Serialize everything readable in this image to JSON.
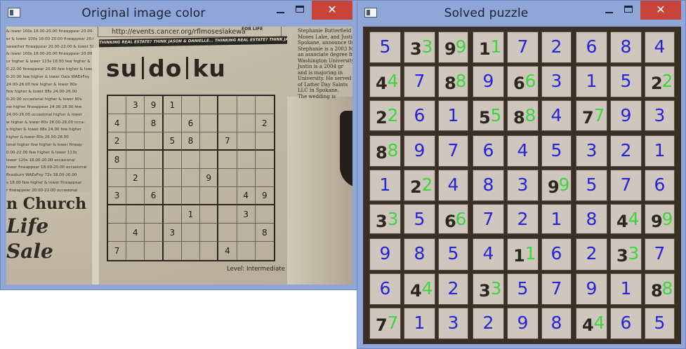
{
  "windows": {
    "original": {
      "title": "Original image color",
      "close_label": "✕"
    },
    "solved": {
      "title": "Solved puzzle",
      "close_label": "✕"
    }
  },
  "newspaper": {
    "url": "http://events.cancer.org/rflmoseslakewa",
    "for_life": "FOR LIFE",
    "banner": "THINKING REAL ESTATE? THINK JASON & DANIELLE... THINKING REAL ESTATE? THINK JASON & DANIELLE... THINKING REAL ESTATE?",
    "logo_parts": [
      "su",
      "do",
      "ku"
    ],
    "level": "Level: Intermediate",
    "church_lines": [
      "n Church",
      "Life",
      "Sale"
    ],
    "left_column": [
      "& lower 100s 18.00-20.00 fineappear 20.00-22.00",
      "er & lower 100s 18.00-20.00 fineappear 20.00-22.00",
      "sweather fineappear 20.00-22.00 & lower 50s",
      "& lower 100s 18.00-20.00 fineappear 20.00-22.00",
      "ur higher & lower 113s 18.00 few higher &",
      "0-22.00 fineappear 20.00 few higher & lower",
      "0-20.00 few higher & lower Dala WAExFoy",
      "24.00-26.00 few higher & lower 80s",
      "few higher & lower 88s 24.00-26.00",
      "0-20.00 occasional higher & lower 80s",
      "ow higher fineappear 24.00-26.00 few",
      "24.00-26.00 occasional higher & lower",
      "w higher & lower 80s 26.00-28.00 occa-",
      "s higher & lower 88s 24.00 few higher",
      "higher & lower 80s 26.00-28.00",
      "ional higher fow higher & lower fineap-",
      "0.00-22.00 few higher & lower 113s",
      "lower 120s 18.00-20.00 occasional",
      "lower fineappear 18.00-20.00 occasional",
      "Rrasburn WAExFoy 72s 18.00-20.00",
      "s 18.00 few higher & lower fineappear",
      "r fineappear 20.00-22.00 occasional",
      "s 18.00-20.00 fineappear 20.00-22.00",
      "lower 88s 18.00-20.00 fineappear",
      "00 occasional lower 100s 15.00-16.00",
      "r 18.00 few higher & lower cartons"
    ],
    "right_column": [
      "Stephanie Butterfield",
      "Moses Lake, and Justin",
      "Spokane, announce their",
      "Stephanie is a 2003 M",
      "an associate degree fr",
      "Washington University",
      "Justin is a 2004 gr",
      "and is majoring in",
      "University. He served",
      "of Latter Day Saints",
      "LLC in Spokane.",
      "The wedding is"
    ],
    "grid": [
      [
        "",
        "3",
        "9",
        "1",
        "",
        "",
        "",
        "",
        ""
      ],
      [
        "4",
        "",
        "8",
        "",
        "6",
        "",
        "",
        "",
        "2"
      ],
      [
        "2",
        "",
        "",
        "5",
        "8",
        "",
        "7",
        "",
        ""
      ],
      [
        "8",
        "",
        "",
        "",
        "",
        "",
        "",
        "",
        ""
      ],
      [
        "",
        "2",
        "",
        "",
        "",
        "9",
        "",
        "",
        ""
      ],
      [
        "3",
        "",
        "6",
        "",
        "",
        "",
        "",
        "4",
        "9"
      ],
      [
        "",
        "",
        "",
        "",
        "1",
        "",
        "",
        "3",
        ""
      ],
      [
        "",
        "4",
        "",
        "3",
        "",
        "",
        "",
        "",
        "8"
      ],
      [
        "7",
        "",
        "",
        "",
        "",
        "",
        "4",
        "",
        ""
      ]
    ]
  },
  "solved_grid": [
    [
      "5",
      "3",
      "9",
      "1",
      "7",
      "2",
      "6",
      "8",
      "4"
    ],
    [
      "4",
      "7",
      "8",
      "9",
      "6",
      "3",
      "1",
      "5",
      "2"
    ],
    [
      "2",
      "6",
      "1",
      "5",
      "8",
      "4",
      "7",
      "9",
      "3"
    ],
    [
      "8",
      "9",
      "7",
      "6",
      "4",
      "5",
      "3",
      "2",
      "1"
    ],
    [
      "1",
      "2",
      "4",
      "8",
      "3",
      "9",
      "5",
      "7",
      "6"
    ],
    [
      "3",
      "5",
      "6",
      "7",
      "2",
      "1",
      "8",
      "4",
      "9"
    ],
    [
      "9",
      "8",
      "5",
      "4",
      "1",
      "6",
      "2",
      "3",
      "7"
    ],
    [
      "6",
      "4",
      "2",
      "3",
      "5",
      "7",
      "9",
      "1",
      "8"
    ],
    [
      "7",
      "1",
      "3",
      "2",
      "9",
      "8",
      "4",
      "6",
      "5"
    ]
  ],
  "colors": {
    "solved_digit": "#2424d8",
    "given_digit": "#3ed63e",
    "titlebar": "#8fa6d8",
    "close": "#c8443b"
  }
}
